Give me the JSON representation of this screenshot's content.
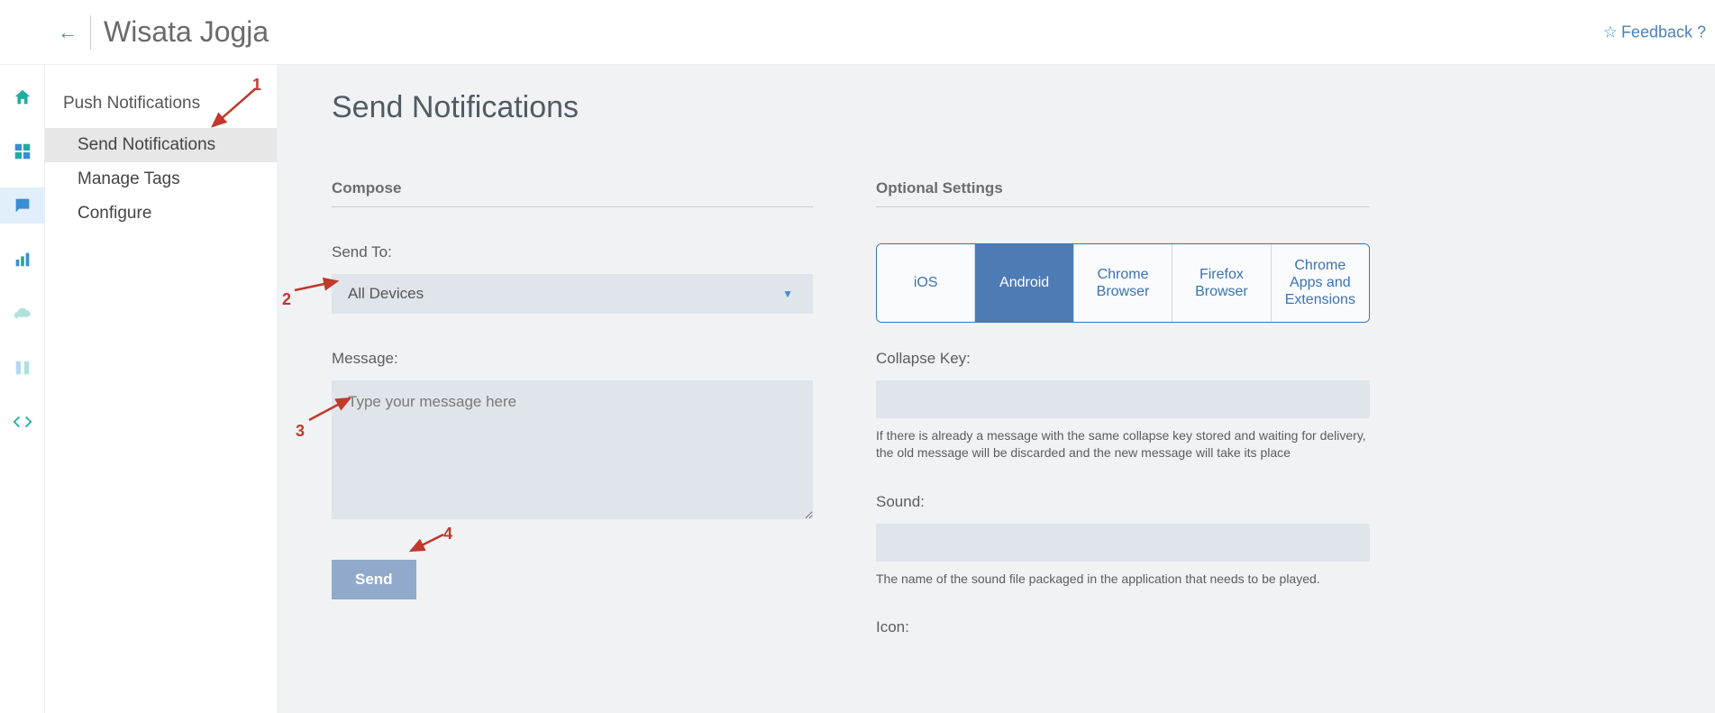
{
  "header": {
    "app_title": "Wisata Jogja",
    "feedback_label": "Feedback ?"
  },
  "rail": {
    "home": "home-icon",
    "dashboard": "dashboard-icon",
    "push": "push-icon",
    "analytics": "analytics-icon",
    "cloud": "cloud-icon",
    "queue": "queue-icon",
    "code": "code-icon"
  },
  "sidebar": {
    "heading": "Push Notifications",
    "items": [
      {
        "label": "Send Notifications",
        "active": true
      },
      {
        "label": "Manage Tags",
        "active": false
      },
      {
        "label": "Configure",
        "active": false
      }
    ]
  },
  "page": {
    "title": "Send Notifications"
  },
  "compose": {
    "section_title": "Compose",
    "send_to_label": "Send To:",
    "send_to_value": "All Devices",
    "message_label": "Message:",
    "message_placeholder": "Type your message here",
    "send_button": "Send"
  },
  "optional": {
    "section_title": "Optional Settings",
    "tabs": [
      {
        "label": "iOS",
        "active": false
      },
      {
        "label": "Android",
        "active": true
      },
      {
        "label": "Chrome Browser",
        "active": false
      },
      {
        "label": "Firefox Browser",
        "active": false
      },
      {
        "label": "Chrome Apps and Extensions",
        "active": false
      }
    ],
    "collapse_key_label": "Collapse Key:",
    "collapse_key_help": "If there is already a message with the same collapse key stored and waiting for delivery, the old message will be discarded and the new message will take its place",
    "sound_label": "Sound:",
    "sound_help": "The name of the sound file packaged in the application that needs to be played.",
    "icon_label": "Icon:"
  },
  "annotations": {
    "n1": "1",
    "n2": "2",
    "n3": "3",
    "n4": "4"
  }
}
